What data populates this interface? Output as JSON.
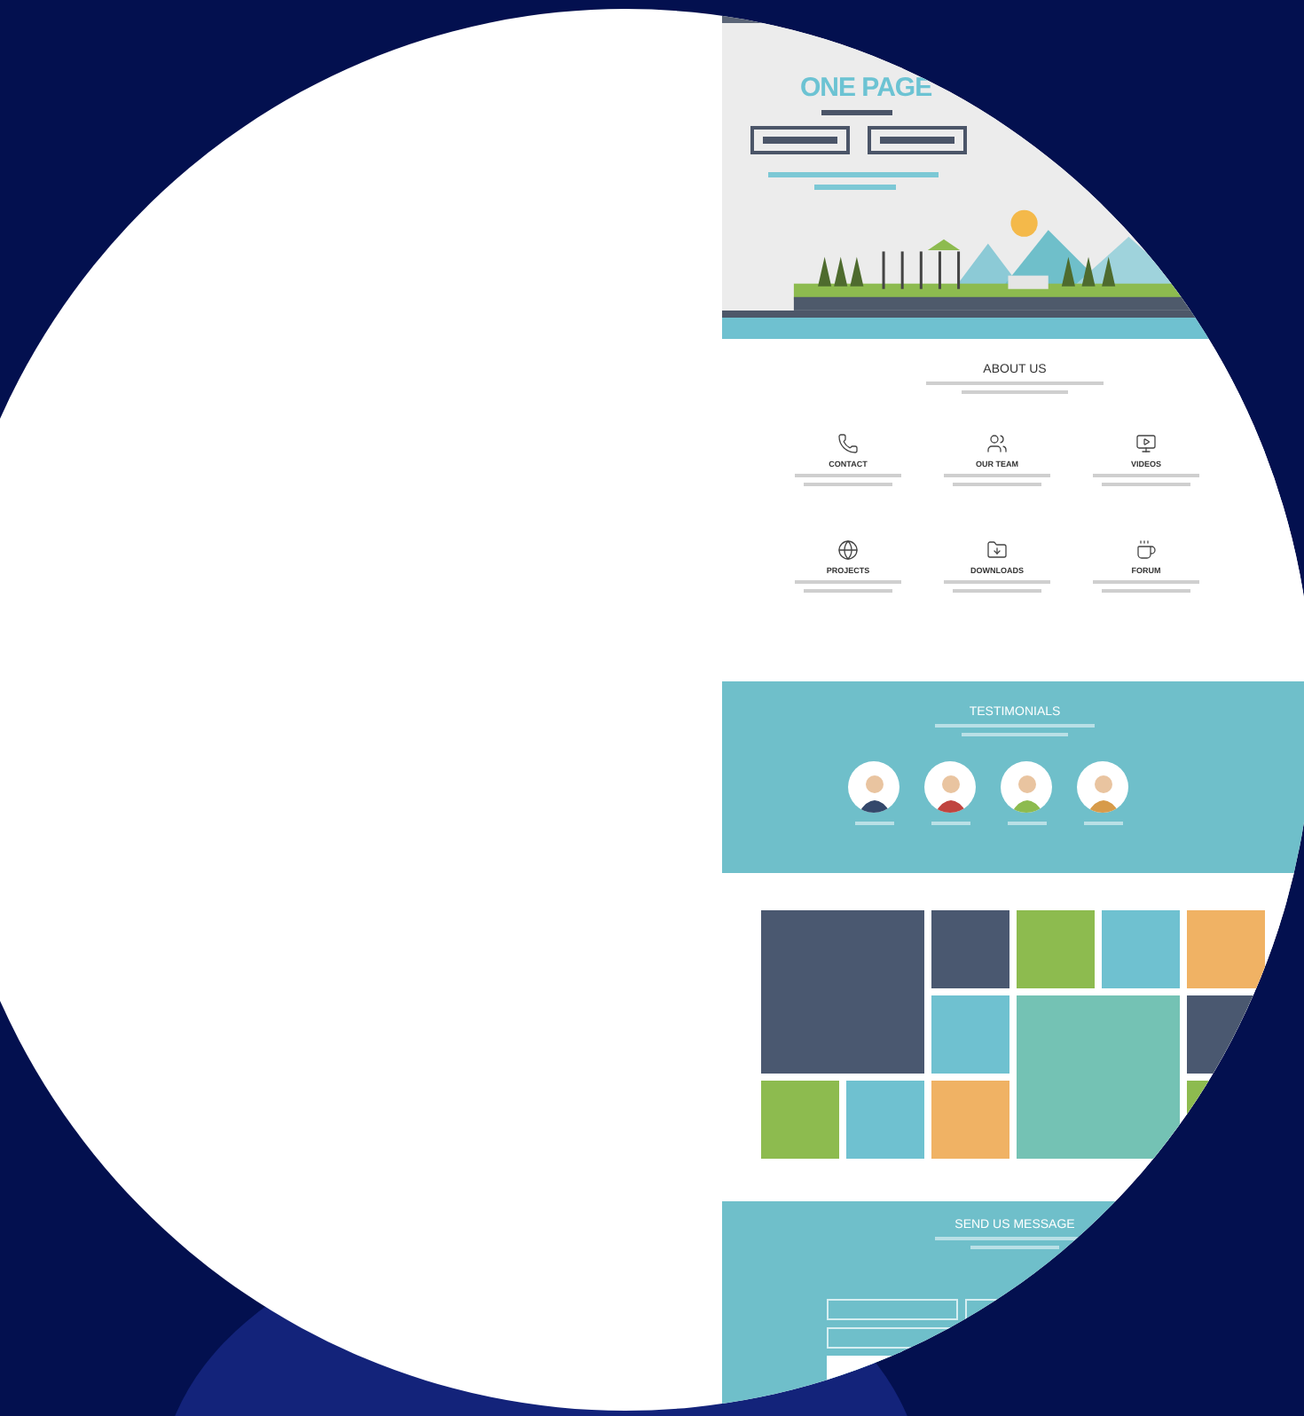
{
  "hero": {
    "title": "ONE PAGE"
  },
  "about": {
    "title": "ABOUT US",
    "features": [
      {
        "label": "CONTACT",
        "kind": "phone"
      },
      {
        "label": "OUR TEAM",
        "kind": "team"
      },
      {
        "label": "VIDEOS",
        "kind": "video"
      },
      {
        "label": "PROJECTS",
        "kind": "globe"
      },
      {
        "label": "DOWNLOADS",
        "kind": "folder"
      },
      {
        "label": "FORUM",
        "kind": "cup"
      }
    ]
  },
  "testimonials": {
    "title": "TESTIMONIALS"
  },
  "gallery": {
    "tiles": [
      {
        "color": "#4a5870",
        "kind": "large"
      },
      {
        "color": "#4a5870",
        "kind": "small"
      },
      {
        "color": "#8dbb4f",
        "kind": "small"
      },
      {
        "color": "#6fc1d0",
        "kind": "small"
      },
      {
        "color": "#f0b264",
        "kind": "small"
      },
      {
        "color": "#6fc1d0",
        "kind": "small"
      },
      {
        "color": "#74c2b4",
        "kind": "large"
      },
      {
        "color": "#4a5870",
        "kind": "small"
      },
      {
        "color": "#8dbb4f",
        "kind": "small"
      },
      {
        "color": "#6fc1d0",
        "kind": "small"
      },
      {
        "color": "#f0b264",
        "kind": "small"
      },
      {
        "color": "#8dbb4f",
        "kind": "small"
      }
    ]
  },
  "contact": {
    "title": "SEND US MESSAGE"
  }
}
